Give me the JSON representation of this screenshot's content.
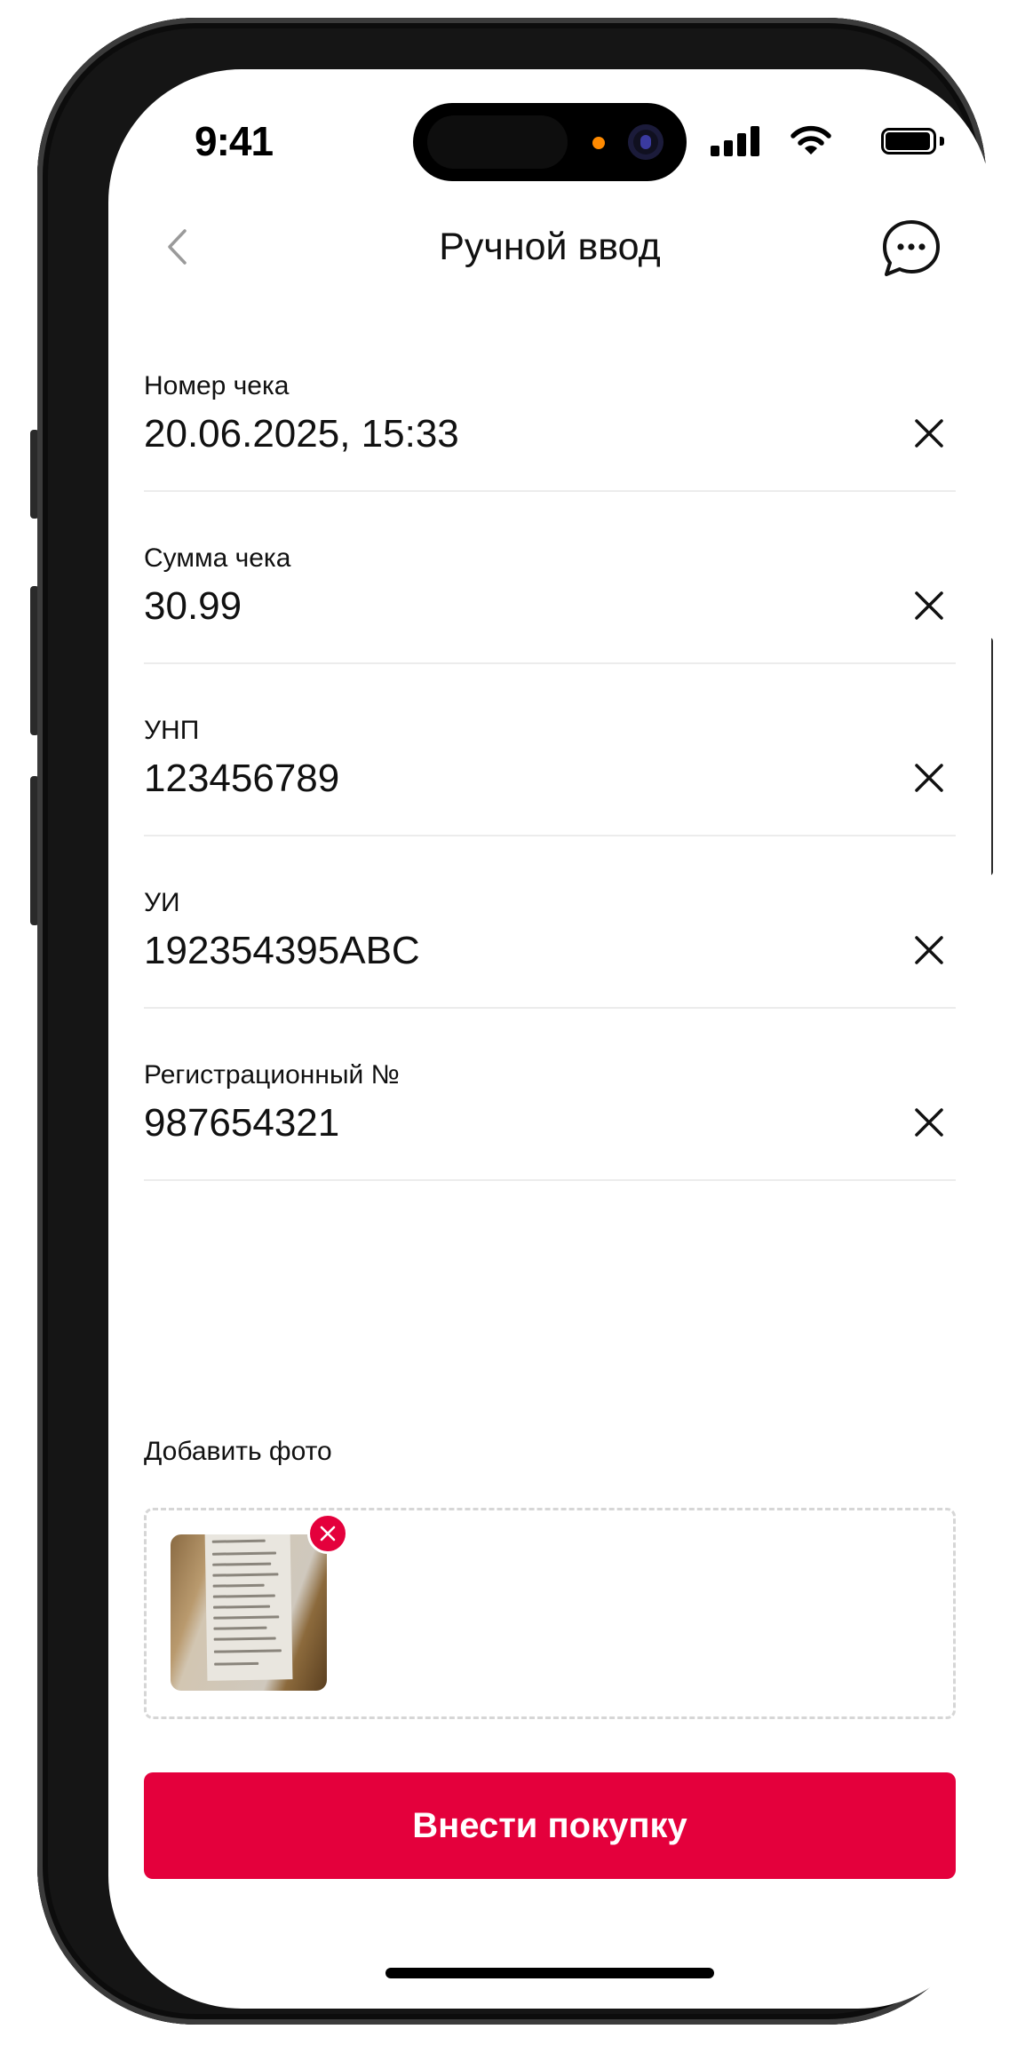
{
  "status_bar": {
    "time": "9:41"
  },
  "header": {
    "title": "Ручной ввод",
    "back_icon": "chevron-left-icon",
    "chat_icon": "chat-bubble-icon"
  },
  "form": {
    "fields": [
      {
        "label": "Номер чека",
        "value": "20.06.2025, 15:33"
      },
      {
        "label": "Сумма чека",
        "value": "30.99"
      },
      {
        "label": "УНП",
        "value": "123456789"
      },
      {
        "label": "УИ",
        "value": "192354395ABC"
      },
      {
        "label": "Регистрационный №",
        "value": "987654321"
      }
    ]
  },
  "photo": {
    "label": "Добавить фото"
  },
  "actions": {
    "submit_label": "Внести покупку"
  },
  "colors": {
    "accent": "#e4003c"
  }
}
